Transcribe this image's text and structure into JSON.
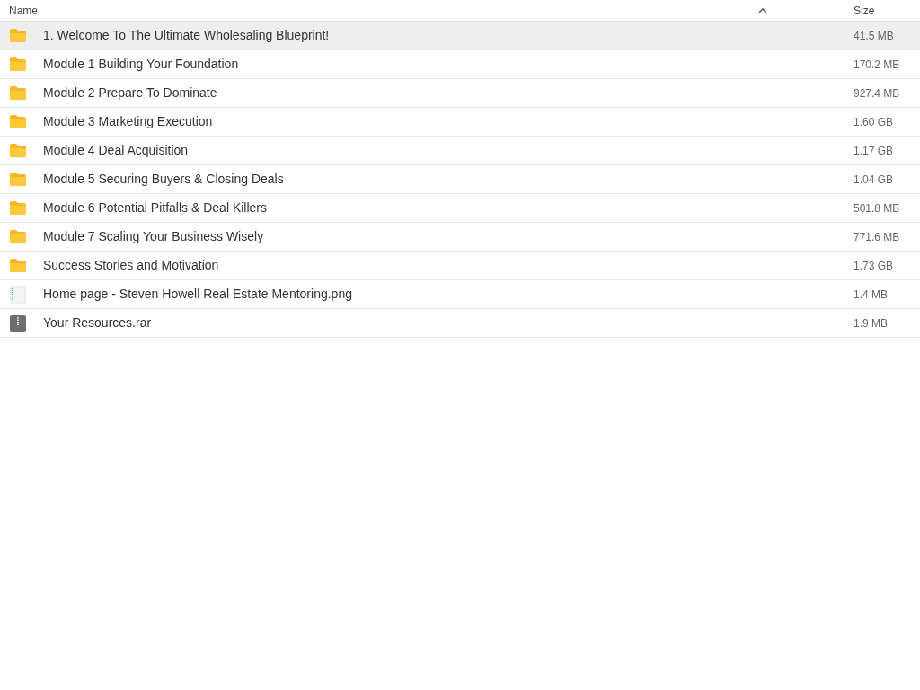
{
  "columns": [
    {
      "label": "Name",
      "sorted": true
    },
    {
      "label": "Size"
    }
  ],
  "rows": [
    {
      "kind": "folder",
      "name": "1. Welcome To The Ultimate Wholesaling Blueprint!",
      "size": "41.5 MB",
      "selected": true
    },
    {
      "kind": "folder",
      "name": "Module 1 Building Your Foundation",
      "size": "170.2 MB",
      "selected": false
    },
    {
      "kind": "folder",
      "name": "Module 2 Prepare To Dominate",
      "size": "927.4 MB",
      "selected": false
    },
    {
      "kind": "folder",
      "name": "Module 3 Marketing Execution",
      "size": "1.60 GB",
      "selected": false
    },
    {
      "kind": "folder",
      "name": "Module 4 Deal Acquisition",
      "size": "1.17 GB",
      "selected": false
    },
    {
      "kind": "folder",
      "name": "Module 5 Securing Buyers & Closing Deals",
      "size": "1.04 GB",
      "selected": false
    },
    {
      "kind": "folder",
      "name": "Module 6 Potential Pitfalls & Deal Killers",
      "size": "501.8 MB",
      "selected": false
    },
    {
      "kind": "folder",
      "name": "Module 7 Scaling Your Business Wisely",
      "size": "771.6 MB",
      "selected": false
    },
    {
      "kind": "folder",
      "name": "Success Stories and Motivation",
      "size": "1.73 GB",
      "selected": false
    },
    {
      "kind": "image",
      "name": "Home page - Steven Howell Real Estate Mentoring.png",
      "size": "1.4 MB",
      "selected": false
    },
    {
      "kind": "archive",
      "name": "Your Resources.rar",
      "size": "1.9 MB",
      "selected": false
    }
  ]
}
